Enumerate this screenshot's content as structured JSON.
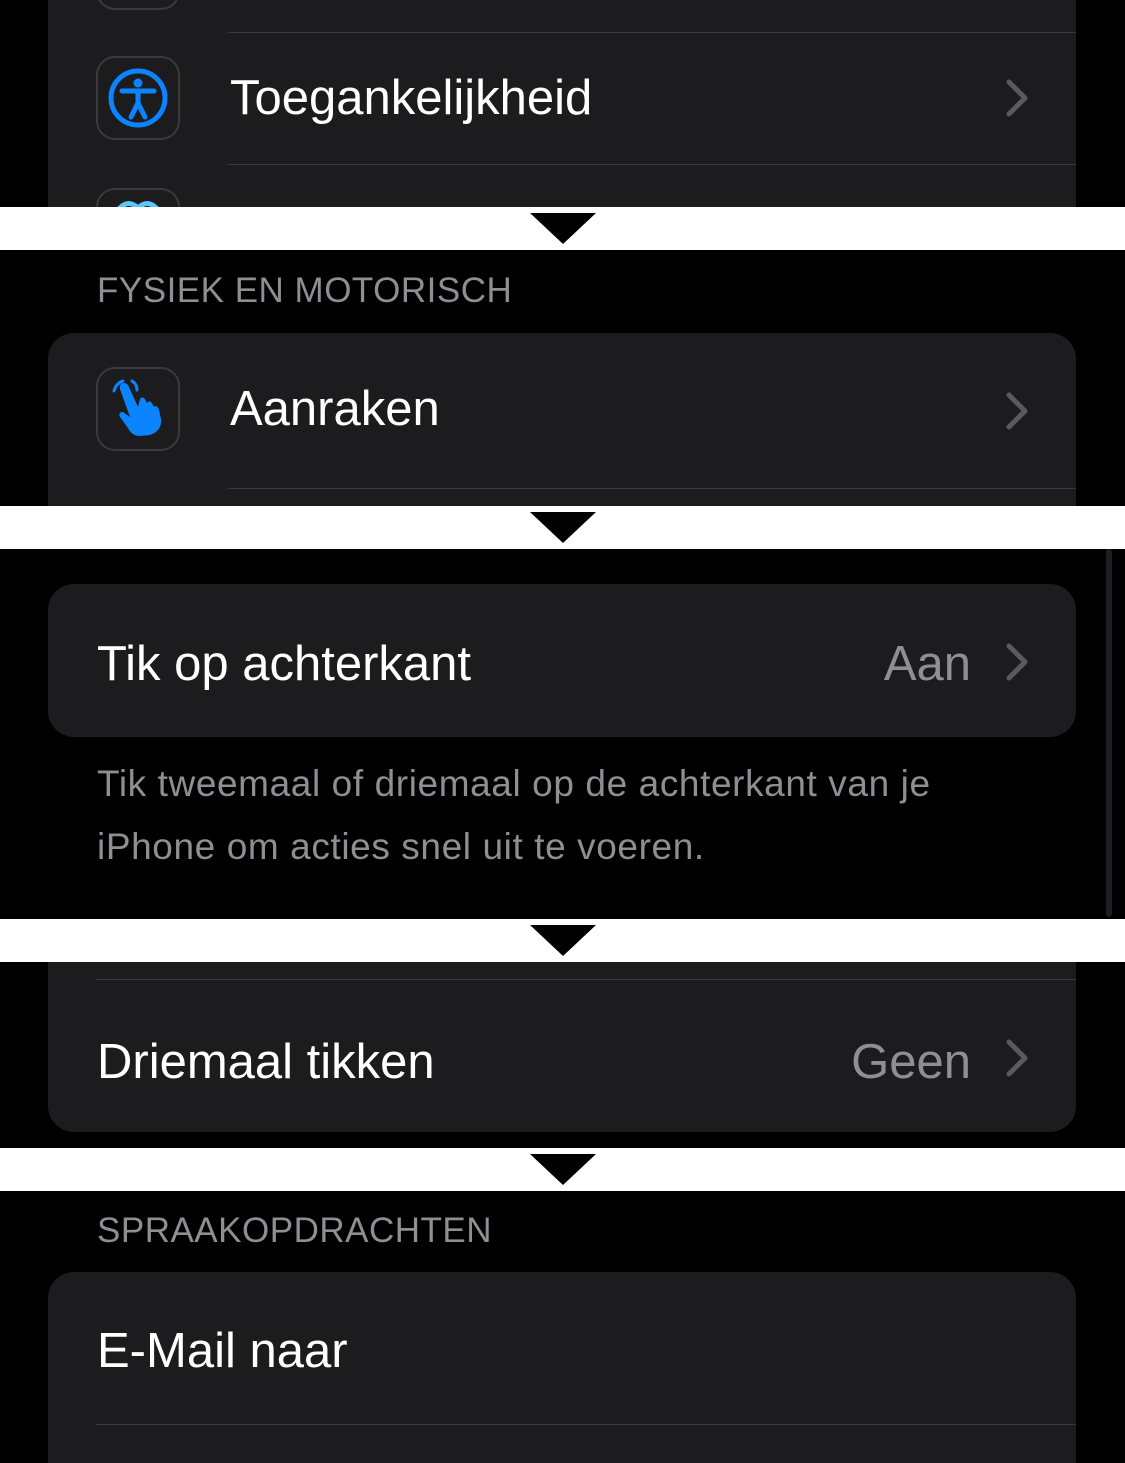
{
  "panel1": {
    "row_accessibility": {
      "label": "Toegankelijkheid",
      "icon": "accessibility-icon"
    }
  },
  "panel2": {
    "section_header": "FYSIEK EN MOTORISCH",
    "row_touch": {
      "label": "Aanraken",
      "icon": "hand-pointer-icon"
    }
  },
  "panel3": {
    "row_back_tap": {
      "label": "Tik op achterkant",
      "value": "Aan"
    },
    "footnote": "Tik tweemaal of driemaal op de achterkant van je iPhone om acties snel uit te voeren."
  },
  "panel4": {
    "row_triple_tap": {
      "label": "Driemaal tikken",
      "value": "Geen"
    }
  },
  "panel5": {
    "section_header": "SPRAAKOPDRACHTEN",
    "row_email": {
      "label": "E-Mail naar"
    }
  },
  "colors": {
    "background": "#000000",
    "cell": "#1c1c1e",
    "accent_blue": "#0a84ff",
    "secondary_text": "#8e8e93",
    "separator": "#38383a"
  }
}
